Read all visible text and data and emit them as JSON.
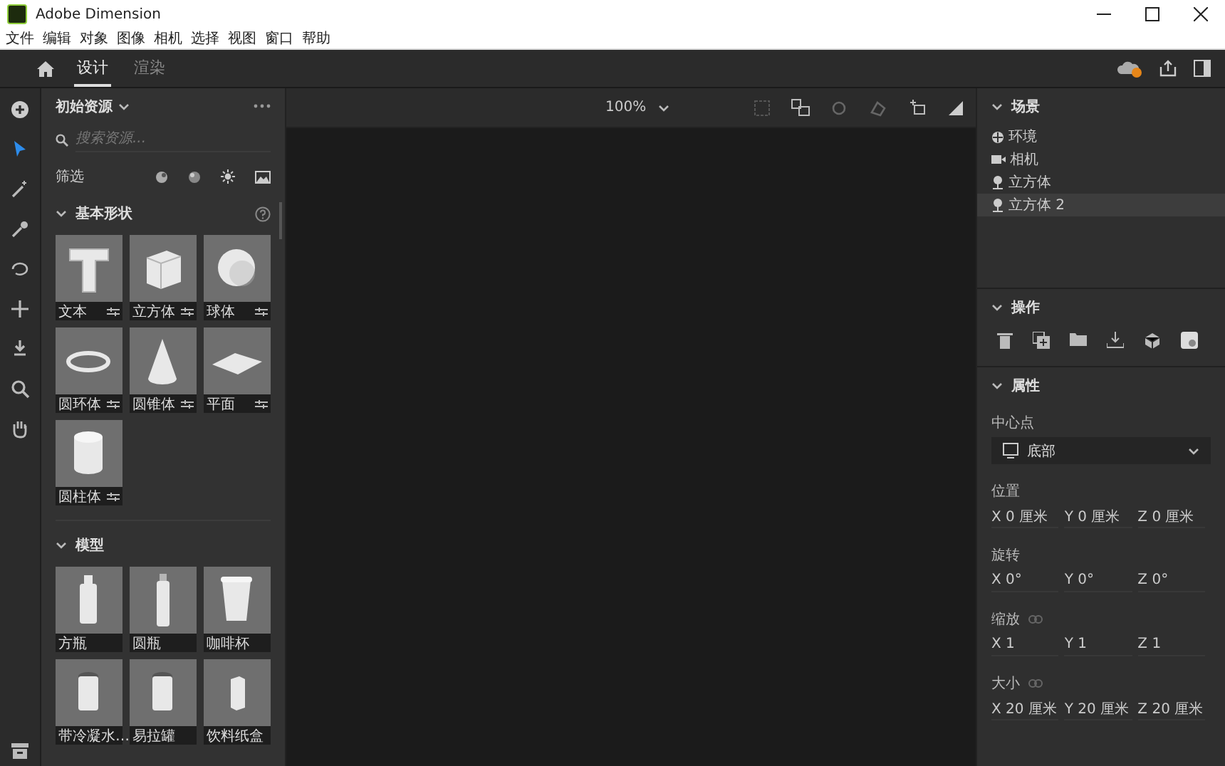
{
  "window": {
    "title": "Adobe Dimension"
  },
  "menu": [
    "文件",
    "编辑",
    "对象",
    "图像",
    "相机",
    "选择",
    "视图",
    "窗口",
    "帮助"
  ],
  "tabs": [
    {
      "label": "设计",
      "selected": true
    },
    {
      "label": "渲染",
      "selected": false
    }
  ],
  "tools": [
    {
      "kind": "add",
      "selected": false
    },
    {
      "kind": "select",
      "selected": true
    },
    {
      "kind": "wand",
      "selected": false
    },
    {
      "kind": "eyedropper",
      "selected": false
    },
    {
      "kind": "orbit",
      "selected": false
    },
    {
      "kind": "move",
      "selected": false
    },
    {
      "kind": "drop",
      "selected": false
    },
    {
      "kind": "zoom",
      "selected": false
    },
    {
      "kind": "hand",
      "selected": false
    }
  ],
  "assets": {
    "title": "初始资源",
    "search_placeholder": "搜索资源...",
    "filter_label": "筛选",
    "sections": [
      {
        "title": "基本形状",
        "expanded": true,
        "help": true,
        "items": [
          {
            "kind": "text",
            "label": "文本",
            "options": true
          },
          {
            "kind": "cube",
            "label": "立方体",
            "options": true
          },
          {
            "kind": "sphere",
            "label": "球体",
            "options": true
          },
          {
            "kind": "torus",
            "label": "圆环体",
            "options": true
          },
          {
            "kind": "cone",
            "label": "圆锥体",
            "options": true
          },
          {
            "kind": "plane",
            "label": "平面",
            "options": true
          },
          {
            "kind": "cylinder",
            "label": "圆柱体",
            "options": true
          }
        ]
      },
      {
        "title": "模型",
        "expanded": true,
        "help": false,
        "items": [
          {
            "kind": "bottle",
            "label": "方瓶",
            "options": false
          },
          {
            "kind": "tube",
            "label": "圆瓶",
            "options": false
          },
          {
            "kind": "cup",
            "label": "咖啡杯",
            "options": false
          },
          {
            "kind": "can",
            "label": "带冷凝水…",
            "options": false
          },
          {
            "kind": "can",
            "label": "易拉罐",
            "options": false
          },
          {
            "kind": "carton",
            "label": "饮料纸盒",
            "options": false
          }
        ]
      }
    ]
  },
  "canvas": {
    "zoom": "100%"
  },
  "scene": {
    "title": "场景",
    "items": [
      {
        "kind": "environment",
        "label": "环境",
        "selected": false
      },
      {
        "kind": "camera",
        "label": "相机",
        "selected": false
      },
      {
        "kind": "model",
        "label": "立方体",
        "selected": false
      },
      {
        "kind": "model",
        "label": "立方体 2",
        "selected": true
      }
    ]
  },
  "actions": {
    "title": "操作"
  },
  "properties": {
    "title": "属性",
    "pivot_label": "中心点",
    "pivot_value": "底部",
    "groups": [
      {
        "label": "位置",
        "linked": false,
        "fields": [
          {
            "axis": "X",
            "value": "0 厘米"
          },
          {
            "axis": "Y",
            "value": "0 厘米"
          },
          {
            "axis": "Z",
            "value": "0 厘米"
          }
        ]
      },
      {
        "label": "旋转",
        "linked": false,
        "fields": [
          {
            "axis": "X",
            "value": "0°"
          },
          {
            "axis": "Y",
            "value": "0°"
          },
          {
            "axis": "Z",
            "value": "0°"
          }
        ]
      },
      {
        "label": "缩放",
        "linked": true,
        "fields": [
          {
            "axis": "X",
            "value": "1"
          },
          {
            "axis": "Y",
            "value": "1"
          },
          {
            "axis": "Z",
            "value": "1"
          }
        ]
      },
      {
        "label": "大小",
        "linked": true,
        "fields": [
          {
            "axis": "X",
            "value": "20 厘米"
          },
          {
            "axis": "Y",
            "value": "20 厘米"
          },
          {
            "axis": "Z",
            "value": "20 厘米"
          }
        ]
      }
    ]
  }
}
